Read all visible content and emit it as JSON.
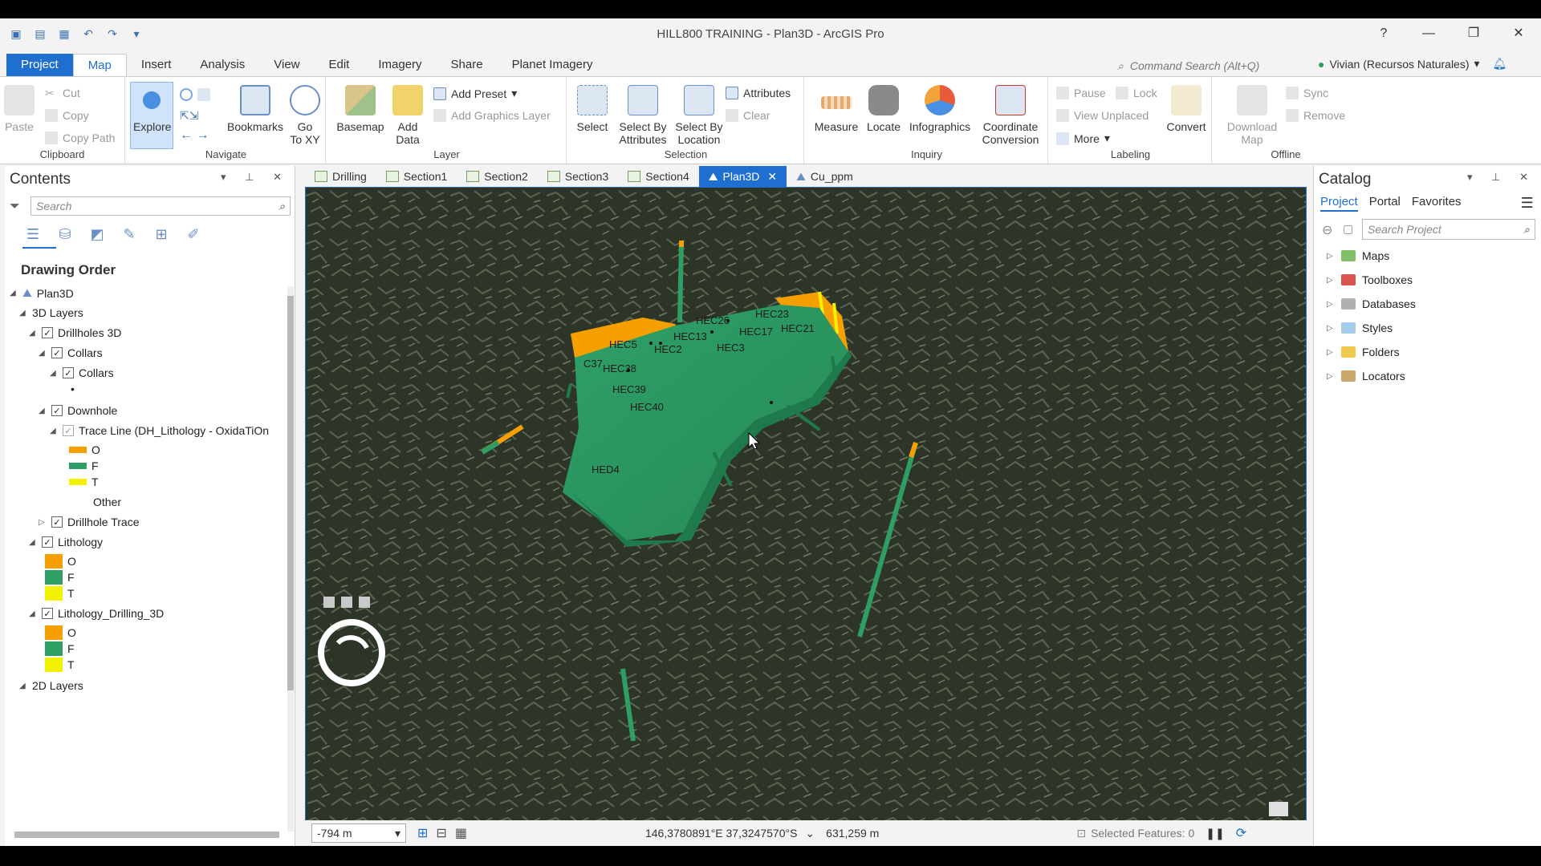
{
  "window": {
    "title": "HILL800 TRAINING - Plan3D - ArcGIS Pro"
  },
  "menu": {
    "tabs": [
      "Project",
      "Map",
      "Insert",
      "Analysis",
      "View",
      "Edit",
      "Imagery",
      "Share",
      "Planet Imagery"
    ],
    "command_search_placeholder": "Command Search (Alt+Q)",
    "user": "Vivian (Recursos Naturales)"
  },
  "ribbon": {
    "clipboard": {
      "label": "Clipboard",
      "paste": "Paste",
      "cut": "Cut",
      "copy": "Copy",
      "copy_path": "Copy Path"
    },
    "navigate": {
      "label": "Navigate",
      "explore": "Explore",
      "bookmarks": "Bookmarks",
      "go_to_xy_1": "Go",
      "go_to_xy_2": "To XY"
    },
    "layer": {
      "label": "Layer",
      "basemap": "Basemap",
      "add_data_1": "Add",
      "add_data_2": "Data",
      "add_preset": "Add Preset",
      "add_graphics_layer": "Add Graphics Layer"
    },
    "selection": {
      "label": "Selection",
      "select": "Select",
      "select_by_attributes_1": "Select By",
      "select_by_attributes_2": "Attributes",
      "select_by_location_1": "Select By",
      "select_by_location_2": "Location",
      "attributes": "Attributes",
      "clear": "Clear"
    },
    "inquiry": {
      "label": "Inquiry",
      "measure": "Measure",
      "locate": "Locate",
      "infographics": "Infographics",
      "coordinate_conversion_1": "Coordinate",
      "coordinate_conversion_2": "Conversion"
    },
    "labeling": {
      "label": "Labeling",
      "pause": "Pause",
      "lock": "Lock",
      "view_unplaced": "View Unplaced",
      "more": "More",
      "convert": "Convert"
    },
    "offline": {
      "label": "Offline",
      "download_map_1": "Download",
      "download_map_2": "Map",
      "sync": "Sync",
      "remove": "Remove"
    }
  },
  "contents": {
    "title": "Contents",
    "search_placeholder": "Search",
    "drawing_order": "Drawing Order",
    "tree": {
      "plan3d": "Plan3D",
      "layers_3d": "3D Layers",
      "drillholes_3d": "Drillholes 3D",
      "collars_group": "Collars",
      "collars_layer": "Collars",
      "downhole": "Downhole",
      "trace_line": "Trace Line (DH_Lithology - OxidaTiOn",
      "o": "O",
      "f": "F",
      "t": "T",
      "other": "Other",
      "drillhole_trace": "Drillhole Trace",
      "lithology": "Lithology",
      "lithology_drilling_3d": "Lithology_Drilling_3D",
      "layers_2d": "2D Layers"
    },
    "colors": {
      "o": "#f5a000",
      "f": "#2e9e64",
      "t": "#f2f200"
    }
  },
  "map_tabs": [
    "Drilling",
    "Section1",
    "Section2",
    "Section3",
    "Section4",
    "Plan3D",
    "Cu_ppm"
  ],
  "map": {
    "labels": [
      "HEC26",
      "HEC23",
      "HEC17",
      "HEC21",
      "HEC5",
      "HEC13",
      "HEC2",
      "HEC3",
      "HEC38",
      "HEC39",
      "HEC40",
      "HED4",
      "C37"
    ]
  },
  "status": {
    "scale": "-794 m",
    "coordinates": "146,3780891°E 37,3247570°S",
    "elevation": "631,259 m",
    "selected_features": "Selected Features: 0"
  },
  "catalog": {
    "title": "Catalog",
    "tabs": [
      "Project",
      "Portal",
      "Favorites"
    ],
    "search_placeholder": "Search Project",
    "items": [
      "Maps",
      "Toolboxes",
      "Databases",
      "Styles",
      "Folders",
      "Locators"
    ]
  }
}
